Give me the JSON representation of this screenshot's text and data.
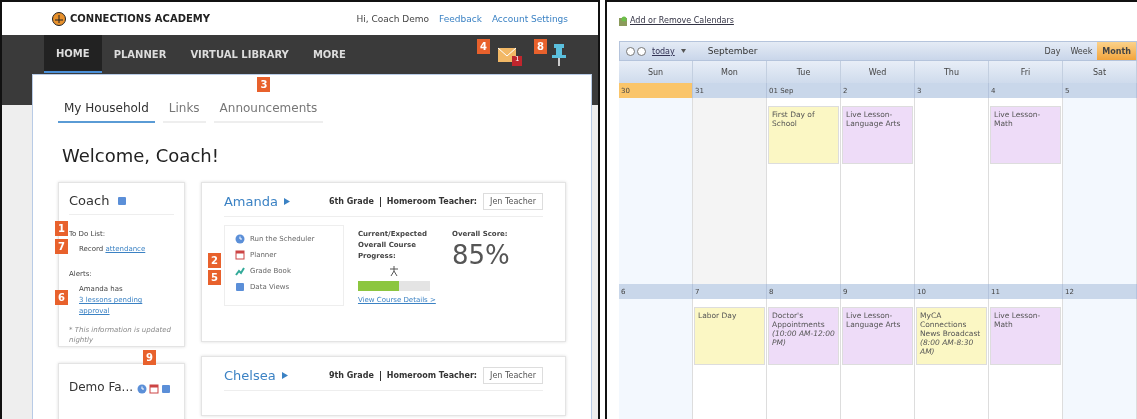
{
  "portal": {
    "brand": "CONNECTIONS ACADEMY",
    "greeting": "Hi, Coach Demo",
    "header_links": [
      "Feedback",
      "Account Settings"
    ],
    "nav": [
      {
        "label": "HOME",
        "selected": true
      },
      {
        "label": "PLANNER",
        "selected": false
      },
      {
        "label": "VIRTUAL LIBRARY",
        "selected": false
      },
      {
        "label": "MORE",
        "selected": false
      }
    ],
    "nav_markers": [
      "4",
      "8"
    ],
    "mail_count": "1",
    "tabs": [
      {
        "label": "My Household",
        "selected": true
      },
      {
        "label": "Links",
        "selected": false
      },
      {
        "label": "Announcements",
        "selected": false,
        "marker": "3"
      }
    ],
    "welcome": "Welcome, Coach!",
    "coach": {
      "name": "Coach",
      "todo_marker": "1",
      "todo_title": "To Do List:",
      "todo_item_marker": "7",
      "todo_text": "Record ",
      "todo_link": "attendance",
      "alerts_title": "Alerts:",
      "alert_marker": "6",
      "alert_text": "Amanda has ",
      "alert_link": "3 lessons pending approval",
      "note": "* This information is updated nightly"
    },
    "family": {
      "name": "Demo Fa...",
      "marker": "9"
    },
    "students": [
      {
        "name": "Amanda",
        "grade": "6th Grade",
        "teacher_label": "Homeroom Teacher:",
        "teacher": "Jen Teacher",
        "links": [
          {
            "label": "Run the Scheduler",
            "kind": "clock"
          },
          {
            "label": "Planner",
            "kind": "calendar",
            "marker": "2"
          },
          {
            "label": "Grade Book",
            "kind": "chart",
            "marker": "5"
          },
          {
            "label": "Data Views",
            "kind": "grid"
          }
        ],
        "progress_label": "Current/Expected Overall Course Progress:",
        "level": 0.57,
        "details_link": "View Course Details >",
        "score_label": "Overall Score:",
        "score": "85%"
      },
      {
        "name": "Chelsea",
        "grade": "9th Grade",
        "teacher_label": "Homeroom Teacher:",
        "teacher": "Jen Teacher"
      }
    ]
  },
  "calendar": {
    "add_link": "Add or Remove Calendars",
    "today": "today",
    "month": "September",
    "views": [
      {
        "label": "Day",
        "selected": false
      },
      {
        "label": "Week",
        "selected": false
      },
      {
        "label": "Month",
        "selected": true
      }
    ],
    "days": [
      "Sun",
      "Mon",
      "Tue",
      "Wed",
      "Thu",
      "Fri",
      "Sat"
    ],
    "weeks": [
      {
        "cells": [
          {
            "date": "30",
            "selected": true
          },
          {
            "date": "31",
            "selected": false
          },
          {
            "date": "01 Sep",
            "selected": false,
            "events": [
              {
                "title": "First Day of School",
                "color": "#fbf7c4"
              }
            ]
          },
          {
            "date": "2",
            "selected": false,
            "events": [
              {
                "title": "Live Lesson- Language Arts",
                "color": "#eedcf8"
              }
            ]
          },
          {
            "date": "3",
            "selected": false
          },
          {
            "date": "4",
            "selected": false,
            "events": [
              {
                "title": "Live Lesson- Math",
                "color": "#eedcf8"
              }
            ]
          },
          {
            "date": "5",
            "selected": false
          }
        ]
      },
      {
        "cells": [
          {
            "date": "6",
            "selected": false
          },
          {
            "date": "7",
            "selected": false,
            "events": [
              {
                "title": "Labor Day",
                "color": "#fbf7c4"
              }
            ]
          },
          {
            "date": "8",
            "selected": false,
            "events": [
              {
                "title": "Doctor's Appointments",
                "time": "(10:00 AM-12:00 PM)",
                "color": "#eedcf8"
              }
            ]
          },
          {
            "date": "9",
            "selected": false,
            "events": [
              {
                "title": "Live Lesson- Language Arts",
                "color": "#eedcf8"
              }
            ]
          },
          {
            "date": "10",
            "selected": false,
            "events": [
              {
                "title": "MyCA Connections News Broadcast",
                "time": "(8:00 AM-8:30 AM)",
                "color": "#fbf7c4"
              }
            ]
          },
          {
            "date": "11",
            "selected": false,
            "events": [
              {
                "title": "Live Lesson- Math",
                "color": "#eedcf8"
              }
            ]
          },
          {
            "date": "12",
            "selected": false
          }
        ]
      }
    ]
  }
}
